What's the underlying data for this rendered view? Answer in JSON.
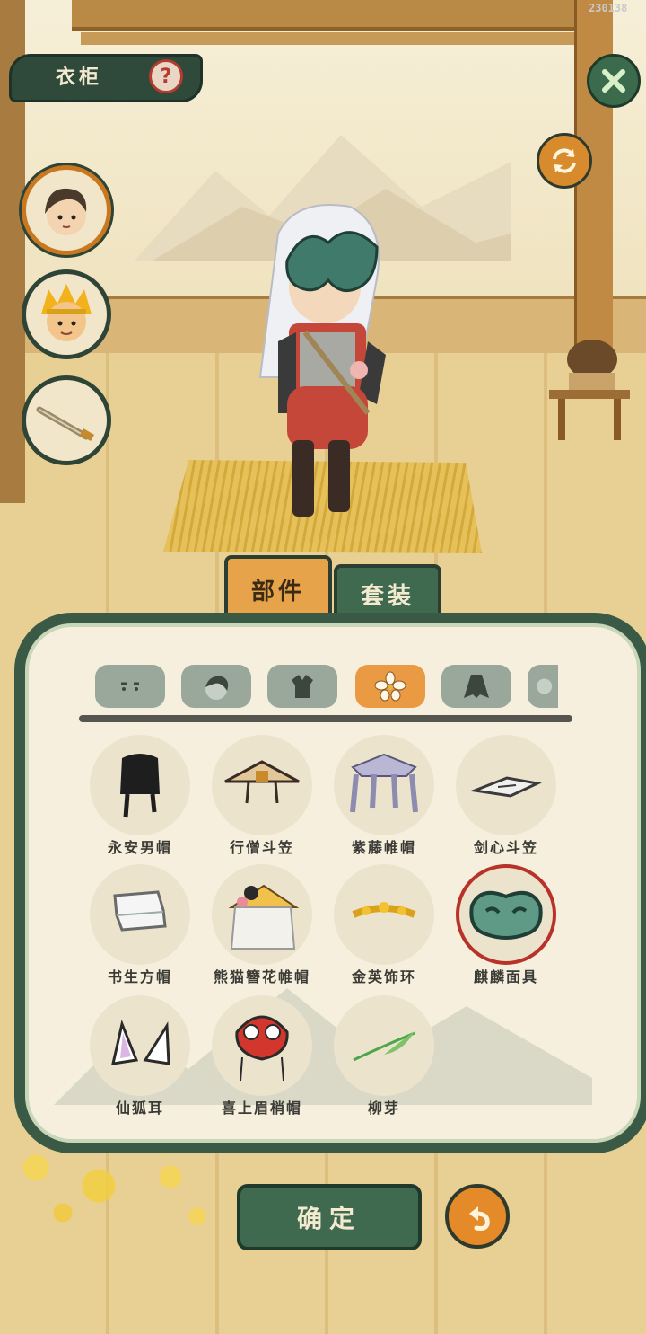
{
  "build_id": "230138",
  "header": {
    "title": "衣柜",
    "help_icon": "question-icon"
  },
  "tabs": [
    {
      "label": "部件",
      "active": true
    },
    {
      "label": "套装",
      "active": false
    }
  ],
  "categories": [
    {
      "icon": "face-icon",
      "active": false
    },
    {
      "icon": "hair-icon",
      "active": false
    },
    {
      "icon": "clothes-icon",
      "active": false
    },
    {
      "icon": "flower-icon",
      "active": true
    },
    {
      "icon": "cloak-icon",
      "active": false
    },
    {
      "icon": "more-icon",
      "active": false
    }
  ],
  "items": [
    {
      "label": "永安男帽",
      "icon": "black-hat-icon"
    },
    {
      "label": "行僧斗笠",
      "icon": "straw-hat-icon"
    },
    {
      "label": "紫藤帷帽",
      "icon": "veil-hat-icon"
    },
    {
      "label": "剑心斗笠",
      "icon": "flat-hat-icon"
    },
    {
      "label": "书生方帽",
      "icon": "scholar-hat-icon"
    },
    {
      "label": "熊猫簪花帷帽",
      "icon": "panda-hat-icon"
    },
    {
      "label": "金英饰环",
      "icon": "gold-circlet-icon"
    },
    {
      "label": "麒麟面具",
      "icon": "qilin-mask-icon",
      "selected": true
    },
    {
      "label": "仙狐耳",
      "icon": "fox-ears-icon"
    },
    {
      "label": "喜上眉梢帽",
      "icon": "lion-hat-icon"
    },
    {
      "label": "柳芽",
      "icon": "willow-sprout-icon"
    }
  ],
  "buttons": {
    "confirm": "确定"
  },
  "colors": {
    "accent": "#3f6a4f",
    "highlight": "#e99a42",
    "selected_ring": "#b8322a"
  }
}
